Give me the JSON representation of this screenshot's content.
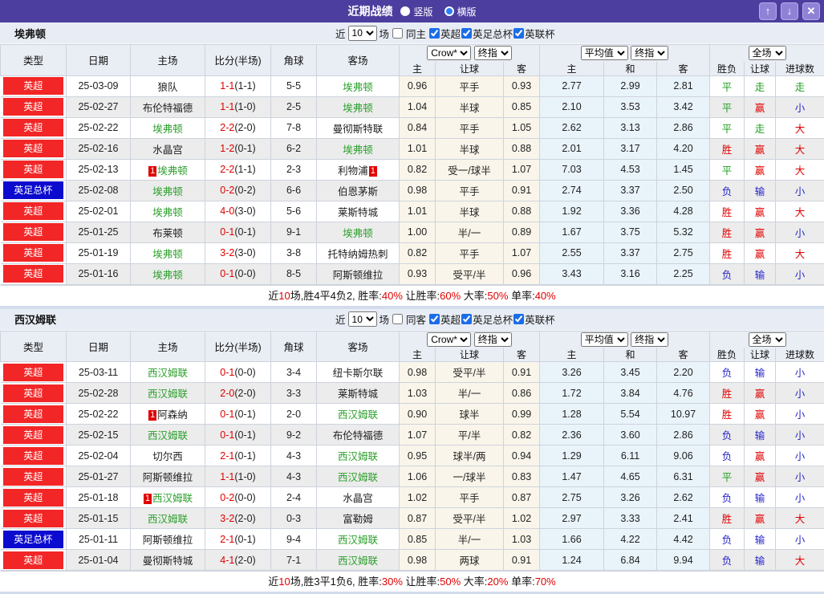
{
  "titlebar": {
    "title": "近期战绩",
    "radios": [
      {
        "label": "竖版",
        "selected": true
      },
      {
        "label": "横版",
        "selected": false
      }
    ],
    "buttons": {
      "up": "↑",
      "down": "↓",
      "close": "✕"
    }
  },
  "colors": {
    "titlebar_purple": "#4c3e9e",
    "league_red": "#f22626",
    "league_blue": "#0b0bd0",
    "team_green": "#2da02d",
    "score_red": "#e10000",
    "loss_blue": "#2626cc",
    "cream_col": "#faf5ea",
    "avg_col": "#e9f3fa"
  },
  "table_headers": {
    "type": "类型",
    "date": "日期",
    "home": "主场",
    "score": "比分(半场)",
    "corner": "角球",
    "away": "客场",
    "sub": [
      "主",
      "让球",
      "客",
      "主",
      "和",
      "客",
      "胜负",
      "让球",
      "进球数"
    ]
  },
  "sections": [
    {
      "team": "埃弗顿",
      "filter": {
        "near": "近",
        "count": "10",
        "games": "场",
        "same_label": "同主",
        "same_checked": false,
        "leagues": [
          {
            "label": "英超",
            "checked": true
          },
          {
            "label": "英足总杯",
            "checked": true
          },
          {
            "label": "英联杯",
            "checked": true
          }
        ]
      },
      "selects": {
        "odds_source": "Crow*",
        "odds_time": "终指",
        "avg_source": "平均值",
        "avg_time": "终指",
        "scope": "全场"
      },
      "rows": [
        {
          "type": "英超",
          "type_color": "red",
          "date": "25-03-09",
          "home": "狼队",
          "home_green": false,
          "home_badge": "",
          "score": "1-1",
          "half": "(1-1)",
          "corner": "5-5",
          "away": "埃弗顿",
          "away_green": true,
          "away_badge": "",
          "o_home": "0.96",
          "handicap": "平手",
          "o_away": "0.93",
          "avg_home": "2.77",
          "avg_draw": "2.99",
          "avg_away": "2.81",
          "result": "平",
          "handicap_result": "走",
          "goal_result": "走"
        },
        {
          "type": "英超",
          "type_color": "red",
          "date": "25-02-27",
          "home": "布伦特福德",
          "home_green": false,
          "home_badge": "",
          "score": "1-1",
          "half": "(1-0)",
          "corner": "2-5",
          "away": "埃弗顿",
          "away_green": true,
          "away_badge": "",
          "o_home": "1.04",
          "handicap": "半球",
          "o_away": "0.85",
          "avg_home": "2.10",
          "avg_draw": "3.53",
          "avg_away": "3.42",
          "result": "平",
          "handicap_result": "赢",
          "goal_result": "小"
        },
        {
          "type": "英超",
          "type_color": "red",
          "date": "25-02-22",
          "home": "埃弗顿",
          "home_green": true,
          "home_badge": "",
          "score": "2-2",
          "half": "(2-0)",
          "corner": "7-8",
          "away": "曼彻斯特联",
          "away_green": false,
          "away_badge": "",
          "o_home": "0.84",
          "handicap": "平手",
          "o_away": "1.05",
          "avg_home": "2.62",
          "avg_draw": "3.13",
          "avg_away": "2.86",
          "result": "平",
          "handicap_result": "走",
          "goal_result": "大"
        },
        {
          "type": "英超",
          "type_color": "red",
          "date": "25-02-16",
          "home": "水晶宫",
          "home_green": false,
          "home_badge": "",
          "score": "1-2",
          "half": "(0-1)",
          "corner": "6-2",
          "away": "埃弗顿",
          "away_green": true,
          "away_badge": "",
          "o_home": "1.01",
          "handicap": "半球",
          "o_away": "0.88",
          "avg_home": "2.01",
          "avg_draw": "3.17",
          "avg_away": "4.20",
          "result": "胜",
          "handicap_result": "赢",
          "goal_result": "大"
        },
        {
          "type": "英超",
          "type_color": "red",
          "date": "25-02-13",
          "home": "埃弗顿",
          "home_green": true,
          "home_badge": "1",
          "score": "2-2",
          "half": "(1-1)",
          "corner": "2-3",
          "away": "利物浦",
          "away_green": false,
          "away_badge": "1",
          "o_home": "0.82",
          "handicap": "受一/球半",
          "o_away": "1.07",
          "avg_home": "7.03",
          "avg_draw": "4.53",
          "avg_away": "1.45",
          "result": "平",
          "handicap_result": "赢",
          "goal_result": "大"
        },
        {
          "type": "英足总杯",
          "type_color": "blue",
          "date": "25-02-08",
          "home": "埃弗顿",
          "home_green": true,
          "home_badge": "",
          "score": "0-2",
          "half": "(0-2)",
          "corner": "6-6",
          "away": "伯恩茅斯",
          "away_green": false,
          "away_badge": "",
          "o_home": "0.98",
          "handicap": "平手",
          "o_away": "0.91",
          "avg_home": "2.74",
          "avg_draw": "3.37",
          "avg_away": "2.50",
          "result": "负",
          "handicap_result": "输",
          "goal_result": "小"
        },
        {
          "type": "英超",
          "type_color": "red",
          "date": "25-02-01",
          "home": "埃弗顿",
          "home_green": true,
          "home_badge": "",
          "score": "4-0",
          "half": "(3-0)",
          "corner": "5-6",
          "away": "莱斯特城",
          "away_green": false,
          "away_badge": "",
          "o_home": "1.01",
          "handicap": "半球",
          "o_away": "0.88",
          "avg_home": "1.92",
          "avg_draw": "3.36",
          "avg_away": "4.28",
          "result": "胜",
          "handicap_result": "赢",
          "goal_result": "大"
        },
        {
          "type": "英超",
          "type_color": "red",
          "date": "25-01-25",
          "home": "布莱顿",
          "home_green": false,
          "home_badge": "",
          "score": "0-1",
          "half": "(0-1)",
          "corner": "9-1",
          "away": "埃弗顿",
          "away_green": true,
          "away_badge": "",
          "o_home": "1.00",
          "handicap": "半/一",
          "o_away": "0.89",
          "avg_home": "1.67",
          "avg_draw": "3.75",
          "avg_away": "5.32",
          "result": "胜",
          "handicap_result": "赢",
          "goal_result": "小"
        },
        {
          "type": "英超",
          "type_color": "red",
          "date": "25-01-19",
          "home": "埃弗顿",
          "home_green": true,
          "home_badge": "",
          "score": "3-2",
          "half": "(3-0)",
          "corner": "3-8",
          "away": "托特纳姆热刺",
          "away_green": false,
          "away_badge": "",
          "o_home": "0.82",
          "handicap": "平手",
          "o_away": "1.07",
          "avg_home": "2.55",
          "avg_draw": "3.37",
          "avg_away": "2.75",
          "result": "胜",
          "handicap_result": "赢",
          "goal_result": "大"
        },
        {
          "type": "英超",
          "type_color": "red",
          "date": "25-01-16",
          "home": "埃弗顿",
          "home_green": true,
          "home_badge": "",
          "score": "0-1",
          "half": "(0-0)",
          "corner": "8-5",
          "away": "阿斯顿维拉",
          "away_green": false,
          "away_badge": "",
          "o_home": "0.93",
          "handicap": "受平/半",
          "o_away": "0.96",
          "avg_home": "3.43",
          "avg_draw": "3.16",
          "avg_away": "2.25",
          "result": "负",
          "handicap_result": "输",
          "goal_result": "小"
        }
      ],
      "summary": [
        {
          "t": "近",
          "red": false
        },
        {
          "t": "10",
          "red": true
        },
        {
          "t": "场,胜4平4负2, 胜率:",
          "red": false
        },
        {
          "t": "40%",
          "red": true
        },
        {
          "t": " 让胜率:",
          "red": false
        },
        {
          "t": "60%",
          "red": true
        },
        {
          "t": " 大率:",
          "red": false
        },
        {
          "t": "50%",
          "red": true
        },
        {
          "t": " 单率:",
          "red": false
        },
        {
          "t": "40%",
          "red": true
        }
      ]
    },
    {
      "team": "西汉姆联",
      "filter": {
        "near": "近",
        "count": "10",
        "games": "场",
        "same_label": "同客",
        "same_checked": false,
        "leagues": [
          {
            "label": "英超",
            "checked": true
          },
          {
            "label": "英足总杯",
            "checked": true
          },
          {
            "label": "英联杯",
            "checked": true
          }
        ]
      },
      "selects": {
        "odds_source": "Crow*",
        "odds_time": "终指",
        "avg_source": "平均值",
        "avg_time": "终指",
        "scope": "全场"
      },
      "rows": [
        {
          "type": "英超",
          "type_color": "red",
          "date": "25-03-11",
          "home": "西汉姆联",
          "home_green": true,
          "home_badge": "",
          "score": "0-1",
          "half": "(0-0)",
          "corner": "3-4",
          "away": "纽卡斯尔联",
          "away_green": false,
          "away_badge": "",
          "o_home": "0.98",
          "handicap": "受平/半",
          "o_away": "0.91",
          "avg_home": "3.26",
          "avg_draw": "3.45",
          "avg_away": "2.20",
          "result": "负",
          "handicap_result": "输",
          "goal_result": "小"
        },
        {
          "type": "英超",
          "type_color": "red",
          "date": "25-02-28",
          "home": "西汉姆联",
          "home_green": true,
          "home_badge": "",
          "score": "2-0",
          "half": "(2-0)",
          "corner": "3-3",
          "away": "莱斯特城",
          "away_green": false,
          "away_badge": "",
          "o_home": "1.03",
          "handicap": "半/一",
          "o_away": "0.86",
          "avg_home": "1.72",
          "avg_draw": "3.84",
          "avg_away": "4.76",
          "result": "胜",
          "handicap_result": "赢",
          "goal_result": "小"
        },
        {
          "type": "英超",
          "type_color": "red",
          "date": "25-02-22",
          "home": "阿森纳",
          "home_green": false,
          "home_badge": "1",
          "score": "0-1",
          "half": "(0-1)",
          "corner": "2-0",
          "away": "西汉姆联",
          "away_green": true,
          "away_badge": "",
          "o_home": "0.90",
          "handicap": "球半",
          "o_away": "0.99",
          "avg_home": "1.28",
          "avg_draw": "5.54",
          "avg_away": "10.97",
          "result": "胜",
          "handicap_result": "赢",
          "goal_result": "小"
        },
        {
          "type": "英超",
          "type_color": "red",
          "date": "25-02-15",
          "home": "西汉姆联",
          "home_green": true,
          "home_badge": "",
          "score": "0-1",
          "half": "(0-1)",
          "corner": "9-2",
          "away": "布伦特福德",
          "away_green": false,
          "away_badge": "",
          "o_home": "1.07",
          "handicap": "平/半",
          "o_away": "0.82",
          "avg_home": "2.36",
          "avg_draw": "3.60",
          "avg_away": "2.86",
          "result": "负",
          "handicap_result": "输",
          "goal_result": "小"
        },
        {
          "type": "英超",
          "type_color": "red",
          "date": "25-02-04",
          "home": "切尔西",
          "home_green": false,
          "home_badge": "",
          "score": "2-1",
          "half": "(0-1)",
          "corner": "4-3",
          "away": "西汉姆联",
          "away_green": true,
          "away_badge": "",
          "o_home": "0.95",
          "handicap": "球半/两",
          "o_away": "0.94",
          "avg_home": "1.29",
          "avg_draw": "6.11",
          "avg_away": "9.06",
          "result": "负",
          "handicap_result": "赢",
          "goal_result": "小"
        },
        {
          "type": "英超",
          "type_color": "red",
          "date": "25-01-27",
          "home": "阿斯顿维拉",
          "home_green": false,
          "home_badge": "",
          "score": "1-1",
          "half": "(1-0)",
          "corner": "4-3",
          "away": "西汉姆联",
          "away_green": true,
          "away_badge": "",
          "o_home": "1.06",
          "handicap": "一/球半",
          "o_away": "0.83",
          "avg_home": "1.47",
          "avg_draw": "4.65",
          "avg_away": "6.31",
          "result": "平",
          "handicap_result": "赢",
          "goal_result": "小"
        },
        {
          "type": "英超",
          "type_color": "red",
          "date": "25-01-18",
          "home": "西汉姆联",
          "home_green": true,
          "home_badge": "1",
          "score": "0-2",
          "half": "(0-0)",
          "corner": "2-4",
          "away": "水晶宫",
          "away_green": false,
          "away_badge": "",
          "o_home": "1.02",
          "handicap": "平手",
          "o_away": "0.87",
          "avg_home": "2.75",
          "avg_draw": "3.26",
          "avg_away": "2.62",
          "result": "负",
          "handicap_result": "输",
          "goal_result": "小"
        },
        {
          "type": "英超",
          "type_color": "red",
          "date": "25-01-15",
          "home": "西汉姆联",
          "home_green": true,
          "home_badge": "",
          "score": "3-2",
          "half": "(2-0)",
          "corner": "0-3",
          "away": "富勒姆",
          "away_green": false,
          "away_badge": "",
          "o_home": "0.87",
          "handicap": "受平/半",
          "o_away": "1.02",
          "avg_home": "2.97",
          "avg_draw": "3.33",
          "avg_away": "2.41",
          "result": "胜",
          "handicap_result": "赢",
          "goal_result": "大"
        },
        {
          "type": "英足总杯",
          "type_color": "blue",
          "date": "25-01-11",
          "home": "阿斯顿维拉",
          "home_green": false,
          "home_badge": "",
          "score": "2-1",
          "half": "(0-1)",
          "corner": "9-4",
          "away": "西汉姆联",
          "away_green": true,
          "away_badge": "",
          "o_home": "0.85",
          "handicap": "半/一",
          "o_away": "1.03",
          "avg_home": "1.66",
          "avg_draw": "4.22",
          "avg_away": "4.42",
          "result": "负",
          "handicap_result": "输",
          "goal_result": "小"
        },
        {
          "type": "英超",
          "type_color": "red",
          "date": "25-01-04",
          "home": "曼彻斯特城",
          "home_green": false,
          "home_badge": "",
          "score": "4-1",
          "half": "(2-0)",
          "corner": "7-1",
          "away": "西汉姆联",
          "away_green": true,
          "away_badge": "",
          "o_home": "0.98",
          "handicap": "两球",
          "o_away": "0.91",
          "avg_home": "1.24",
          "avg_draw": "6.84",
          "avg_away": "9.94",
          "result": "负",
          "handicap_result": "输",
          "goal_result": "大"
        }
      ],
      "summary": [
        {
          "t": "近",
          "red": false
        },
        {
          "t": "10",
          "red": true
        },
        {
          "t": "场,胜3平1负6, 胜率:",
          "red": false
        },
        {
          "t": "30%",
          "red": true
        },
        {
          "t": " 让胜率:",
          "red": false
        },
        {
          "t": "50%",
          "red": true
        },
        {
          "t": " 大率:",
          "red": false
        },
        {
          "t": "20%",
          "red": true
        },
        {
          "t": " 单率:",
          "red": false
        },
        {
          "t": "70%",
          "red": true
        }
      ]
    }
  ]
}
